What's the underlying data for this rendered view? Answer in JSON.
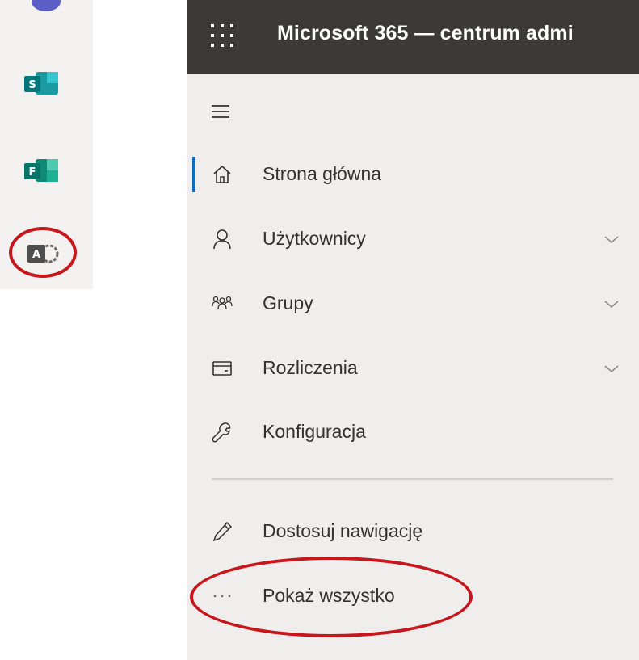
{
  "app_rail": {
    "icons": [
      {
        "name": "teams-icon-partial",
        "color": "#5b5fc7"
      },
      {
        "name": "sharepoint-icon",
        "letter": "S",
        "color": "#03787c"
      },
      {
        "name": "forms-icon",
        "letter": "F",
        "color": "#077568"
      },
      {
        "name": "admin-icon",
        "letter": "A",
        "color": "#4f4f4f"
      }
    ],
    "highlight_color": "#c8161d"
  },
  "topbar": {
    "title": "Microsoft 365 — centrum admi",
    "background": "#3b3a39"
  },
  "nav": {
    "menu_icon": "hamburger-icon",
    "items": [
      {
        "label": "Strona główna",
        "icon": "home-icon",
        "active": true,
        "expandable": false
      },
      {
        "label": "Użytkownicy",
        "icon": "person-icon",
        "active": false,
        "expandable": true
      },
      {
        "label": "Grupy",
        "icon": "group-icon",
        "active": false,
        "expandable": true
      },
      {
        "label": "Rozliczenia",
        "icon": "billing-card-icon",
        "active": false,
        "expandable": true
      },
      {
        "label": "Konfiguracja",
        "icon": "wrench-icon",
        "active": false,
        "expandable": false
      }
    ],
    "secondary_items": [
      {
        "label": "Dostosuj nawigację",
        "icon": "pencil-icon"
      },
      {
        "label": "Pokaż wszystko",
        "icon": "more-icon"
      }
    ],
    "accent": "#0f6cbd"
  }
}
